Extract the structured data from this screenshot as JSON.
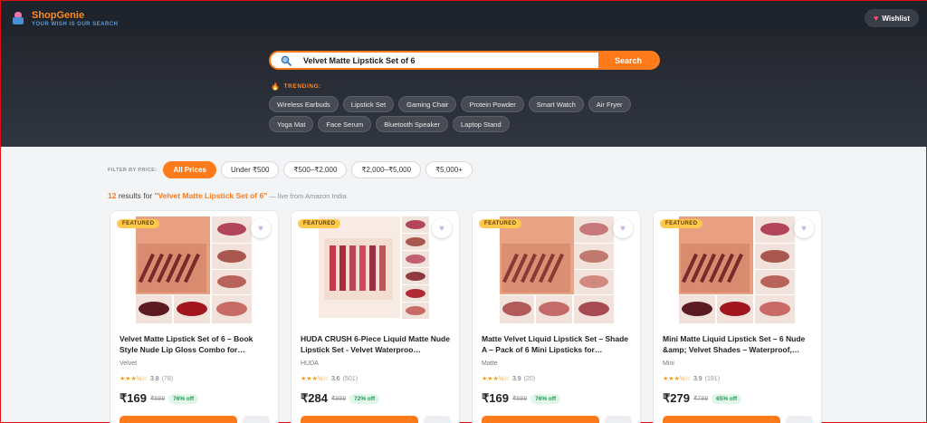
{
  "header": {
    "brand_name": "ShopGenie",
    "tagline": "YOUR WISH IS OUR SEARCH",
    "wishlist_label": "Wishlist"
  },
  "search": {
    "query": "Velvet Matte Lipstick Set of 6",
    "button_label": "Search"
  },
  "trending": {
    "label": "TRENDING:",
    "items": [
      "Wireless Earbuds",
      "Lipstick Set",
      "Gaming Chair",
      "Protein Powder",
      "Smart Watch",
      "Air Fryer",
      "Yoga Mat",
      "Face Serum",
      "Bluetooth Speaker",
      "Laptop Stand"
    ]
  },
  "filters": {
    "label": "FILTER BY PRICE:",
    "options": [
      "All Prices",
      "Under ₹500",
      "₹500–₹2,000",
      "₹2,000–₹5,000",
      "₹5,000+"
    ],
    "active": "All Prices"
  },
  "results": {
    "count": "12",
    "text_mid": " results for ",
    "query_quoted": "\"Velvet Matte Lipstick Set of 6\"",
    "source": " — live from Amazon India"
  },
  "colors": {
    "accent": "#ff7a1a",
    "header_bg": "#1f232b"
  },
  "products": [
    {
      "badge": "FEATURED",
      "title": "Velvet Matte Lipstick Set of 6 – Book Style Nude Lip Gloss Combo for…",
      "brand": "Velvet",
      "stars": "★★★½☆",
      "rating": "3.8",
      "reviews": "(78)",
      "price": "₹169",
      "mrp": "₹699",
      "discount": "76% off"
    },
    {
      "badge": "FEATURED",
      "title": "HUDA CRUSH 6-Piece Liquid Matte Nude Lipstick Set - Velvet Waterproo…",
      "brand": "HUDA",
      "stars": "★★★½☆",
      "rating": "3.6",
      "reviews": "(501)",
      "price": "₹284",
      "mrp": "₹999",
      "discount": "72% off"
    },
    {
      "badge": "FEATURED",
      "title": "Matte Velvet Liquid Lipstick Set – Shade A – Pack of 6 Mini Lipsticks for…",
      "brand": "Matte",
      "stars": "★★★½☆",
      "rating": "3.9",
      "reviews": "(20)",
      "price": "₹169",
      "mrp": "₹699",
      "discount": "76% off"
    },
    {
      "badge": "FEATURED",
      "title": "Mini Matte Liquid Lipstick Set – 6 Nude &amp; Velvet Shades – Waterproof,…",
      "brand": "Mini",
      "stars": "★★★½☆",
      "rating": "3.9",
      "reviews": "(191)",
      "price": "₹279",
      "mrp": "₹799",
      "discount": "65% off"
    }
  ]
}
